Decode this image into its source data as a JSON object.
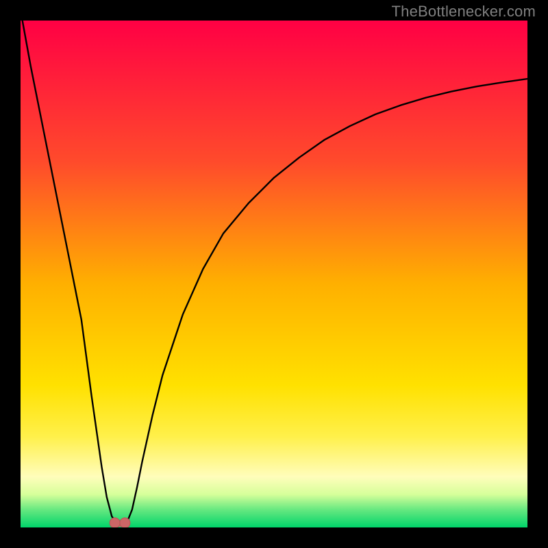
{
  "attribution": "TheBottlenecker.com",
  "colors": {
    "bg": "#000000",
    "attribution_text": "#808080",
    "curve_stroke": "#000000",
    "marker_fill": "#cc6666",
    "marker_stroke": "#b85555",
    "gradient_stops": [
      {
        "offset": 0.0,
        "color": "#ff0044"
      },
      {
        "offset": 0.28,
        "color": "#ff4b2b"
      },
      {
        "offset": 0.52,
        "color": "#ffb000"
      },
      {
        "offset": 0.72,
        "color": "#ffe100"
      },
      {
        "offset": 0.82,
        "color": "#fff04a"
      },
      {
        "offset": 0.9,
        "color": "#fffdbb"
      },
      {
        "offset": 0.935,
        "color": "#d6ff9a"
      },
      {
        "offset": 0.965,
        "color": "#66e880"
      },
      {
        "offset": 1.0,
        "color": "#00d46a"
      }
    ]
  },
  "chart_data": {
    "type": "line",
    "title": "",
    "xlabel": "",
    "ylabel": "",
    "xlim": [
      0,
      100
    ],
    "ylim": [
      0,
      100
    ],
    "grid": false,
    "legend": false,
    "series": [
      {
        "name": "bottleneck-curve",
        "x": [
          0,
          2,
          4,
          6,
          8,
          10,
          12,
          14,
          15,
          16,
          17,
          18,
          19,
          19.5,
          20,
          20.5,
          21,
          22,
          23,
          24,
          26,
          28,
          32,
          36,
          40,
          45,
          50,
          55,
          60,
          65,
          70,
          75,
          80,
          85,
          90,
          95,
          100
        ],
        "y": [
          102,
          91,
          81,
          71,
          61,
          51,
          41,
          26,
          19,
          12,
          6,
          2.2,
          0.7,
          0.7,
          0.7,
          0.7,
          1.0,
          3.5,
          8,
          13,
          22,
          30,
          42,
          51,
          58,
          64,
          69,
          73,
          76.5,
          79.2,
          81.5,
          83.3,
          84.8,
          86,
          87,
          87.8,
          88.5
        ]
      }
    ],
    "annotations": [
      {
        "name": "min-marker-left",
        "x": 18.6,
        "y": 0.9
      },
      {
        "name": "min-marker-right",
        "x": 20.6,
        "y": 0.9
      },
      {
        "name": "min-bridge",
        "x_from": 18.6,
        "x_to": 20.6,
        "y": 0.0
      }
    ],
    "optimal_x": 19.6
  }
}
